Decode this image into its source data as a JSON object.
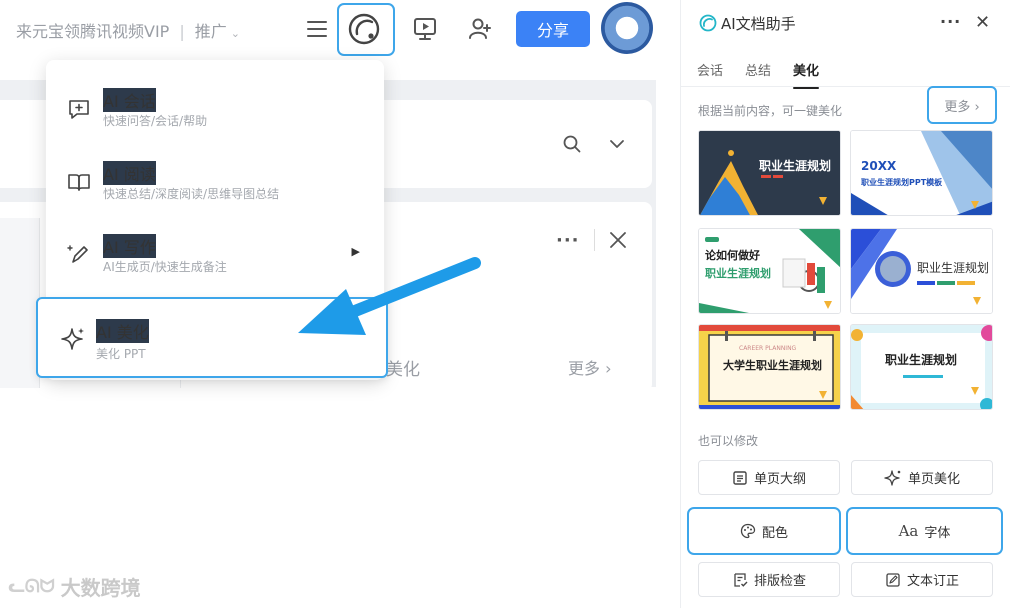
{
  "topbar": {
    "brand": "来元宝领腾讯视频VIP",
    "separator": "|",
    "promo": "推广",
    "caret": "⌄",
    "share_label": "分享"
  },
  "menu": {
    "items": [
      {
        "title": "AI 会话",
        "subtitle": "快速问答/会话/帮助"
      },
      {
        "title": "AI 阅读",
        "subtitle": "快速总结/深度阅读/思维导图总结"
      },
      {
        "title": "AI 写作",
        "subtitle": "AI生成页/快速生成备注",
        "arrow": "▶"
      },
      {
        "title": "AI 美化",
        "subtitle": "美化 PPT"
      }
    ]
  },
  "behind": {
    "text": "美化",
    "more": "更多 ›",
    "dots": "···",
    "close": "✕"
  },
  "panel": {
    "title": "AI文档助手",
    "dots": "···",
    "close": "✕",
    "tabs": [
      "会话",
      "总结",
      "美化"
    ],
    "active_tab": 2,
    "desc": "根据当前内容，可一键美化",
    "more": "更多 ›",
    "templates": [
      {
        "title": "职业生涯规划"
      },
      {
        "title": "20XX",
        "subtitle": "职业生涯规划PPT模板"
      },
      {
        "title": "论如何做好",
        "subtitle": "职业生涯规划"
      },
      {
        "title": "职业生涯规划"
      },
      {
        "title": "大学生职业生涯规划",
        "subtitle": "CAREER PLANNING"
      },
      {
        "title": "职业生涯规划"
      }
    ],
    "also": "也可以修改",
    "buttons": [
      {
        "label": "单页大纲",
        "icon": "outline-icon"
      },
      {
        "label": "单页美化",
        "icon": "sparkle-icon"
      },
      {
        "label": "配色",
        "icon": "palette-icon"
      },
      {
        "label": "字体",
        "icon": "font-icon",
        "icon_text": "Aa"
      },
      {
        "label": "排版检查",
        "icon": "layout-check-icon"
      },
      {
        "label": "文本订正",
        "icon": "text-correct-icon"
      }
    ]
  },
  "watermark": {
    "logo": "ᓚᘏᗢ",
    "text": "大数跨境"
  },
  "colors": {
    "accent": "#3b82f6",
    "highlight": "#3ea6ea"
  }
}
